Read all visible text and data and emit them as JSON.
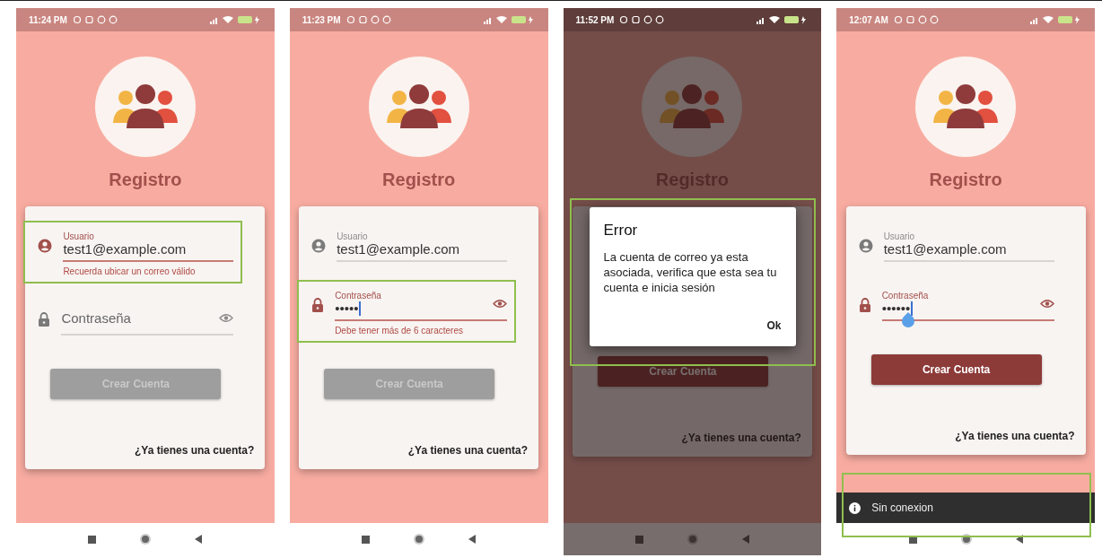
{
  "screens": [
    {
      "status_bar": {
        "time": "11:24 PM"
      },
      "dimmed": false,
      "title": "Registro",
      "card": {
        "fields": [
          {
            "kind": "user",
            "label": "Usuario",
            "value": "test1@example.com",
            "focused": true,
            "error": "Recuerda ubicar un correo válido",
            "highlighted": true
          },
          {
            "kind": "password",
            "placeholder": "Contraseña",
            "focused": false
          }
        ],
        "button": {
          "label": "Crear Cuenta",
          "disabled": true
        },
        "link": "¿Ya tienes una cuenta?"
      }
    },
    {
      "status_bar": {
        "time": "11:23 PM"
      },
      "dimmed": false,
      "title": "Registro",
      "card": {
        "fields": [
          {
            "kind": "user",
            "label": "Usuario",
            "value": "test1@example.com",
            "focused": false,
            "cursor": false
          },
          {
            "kind": "password",
            "label": "Contraseña",
            "value": "•••••",
            "focused": true,
            "cursor": true,
            "error": "Debe tener más de 6 caracteres",
            "highlighted": true
          }
        ],
        "button": {
          "label": "Crear Cuenta",
          "disabled": true
        },
        "link": "¿Ya tienes una cuenta?"
      }
    },
    {
      "status_bar": {
        "time": "11:52 PM"
      },
      "dimmed": true,
      "title": "Registro",
      "card": {
        "button": {
          "label": "Crear Cuenta",
          "disabled": false
        },
        "link": "¿Ya tienes una cuenta?"
      },
      "dialog": {
        "title": "Error",
        "message": "La cuenta de correo ya esta asociada, verifica que esta sea tu cuenta e inicia sesión",
        "action": "Ok",
        "highlighted": true
      }
    },
    {
      "status_bar": {
        "time": "12:07 AM"
      },
      "dimmed": false,
      "title": "Registro",
      "card": {
        "fields": [
          {
            "kind": "user",
            "label": "Usuario",
            "value": "test1@example.com",
            "focused": false,
            "cursor": false
          },
          {
            "kind": "password",
            "label": "Contraseña",
            "value": "••••••",
            "focused": true,
            "cursor": true,
            "selection_handle": true
          }
        ],
        "button": {
          "label": "Crear Cuenta",
          "disabled": false
        },
        "link": "¿Ya tienes una cuenta?"
      },
      "snackbar": {
        "message": "Sin conexion",
        "highlighted": true
      }
    }
  ]
}
